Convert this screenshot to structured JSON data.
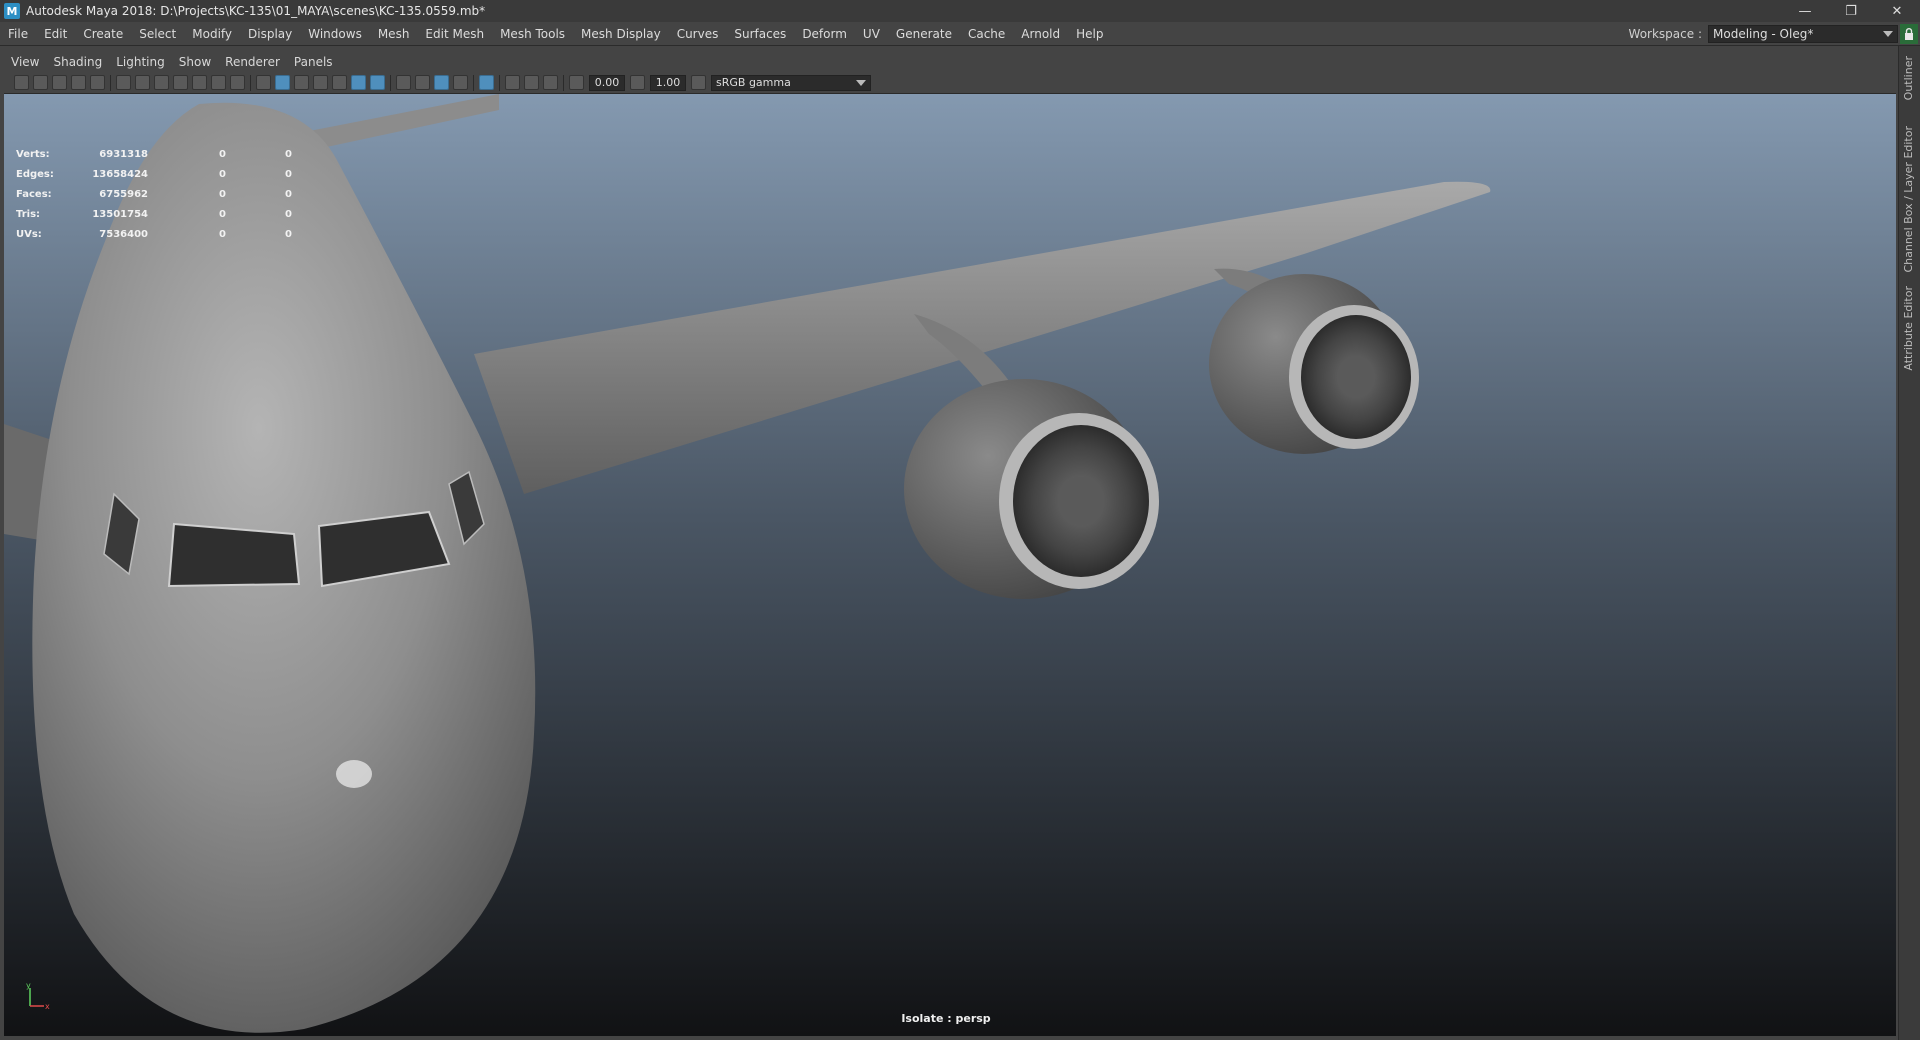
{
  "window": {
    "logo": "M",
    "title": "Autodesk Maya 2018: D:\\Projects\\KC-135\\01_MAYA\\scenes\\KC-135.0559.mb*",
    "minimize": "—",
    "restore": "❐",
    "close": "✕"
  },
  "menu": [
    "File",
    "Edit",
    "Create",
    "Select",
    "Modify",
    "Display",
    "Windows",
    "Mesh",
    "Edit Mesh",
    "Mesh Tools",
    "Mesh Display",
    "Curves",
    "Surfaces",
    "Deform",
    "UV",
    "Generate",
    "Cache",
    "Arnold",
    "Help"
  ],
  "workspace": {
    "label": "Workspace :",
    "value": "Modeling - Oleg*"
  },
  "right_tabs": [
    "Outliner",
    "Channel Box / Layer Editor",
    "Attribute Editor"
  ],
  "panel_menu": [
    "View",
    "Shading",
    "Lighting",
    "Show",
    "Renderer",
    "Panels"
  ],
  "toolbar": {
    "exposure": "0.00",
    "gamma": "1.00",
    "color_space": "sRGB gamma"
  },
  "hud": [
    {
      "label": "Verts:",
      "total": "6931318",
      "selected": "0",
      "highlight": "0"
    },
    {
      "label": "Edges:",
      "total": "13658424",
      "selected": "0",
      "highlight": "0"
    },
    {
      "label": "Faces:",
      "total": "6755962",
      "selected": "0",
      "highlight": "0"
    },
    {
      "label": "Tris:",
      "total": "13501754",
      "selected": "0",
      "highlight": "0"
    },
    {
      "label": "UVs:",
      "total": "7536400",
      "selected": "0",
      "highlight": "0"
    }
  ],
  "viewport_status": "Isolate : persp",
  "axis": {
    "y": "y",
    "x": "x"
  },
  "colors": {
    "viewport_top": "#8499b0",
    "viewport_bottom": "#111214",
    "model": "#8f8f8f",
    "active_tool": "#4f8fbd",
    "lock": "#2a6c39"
  }
}
